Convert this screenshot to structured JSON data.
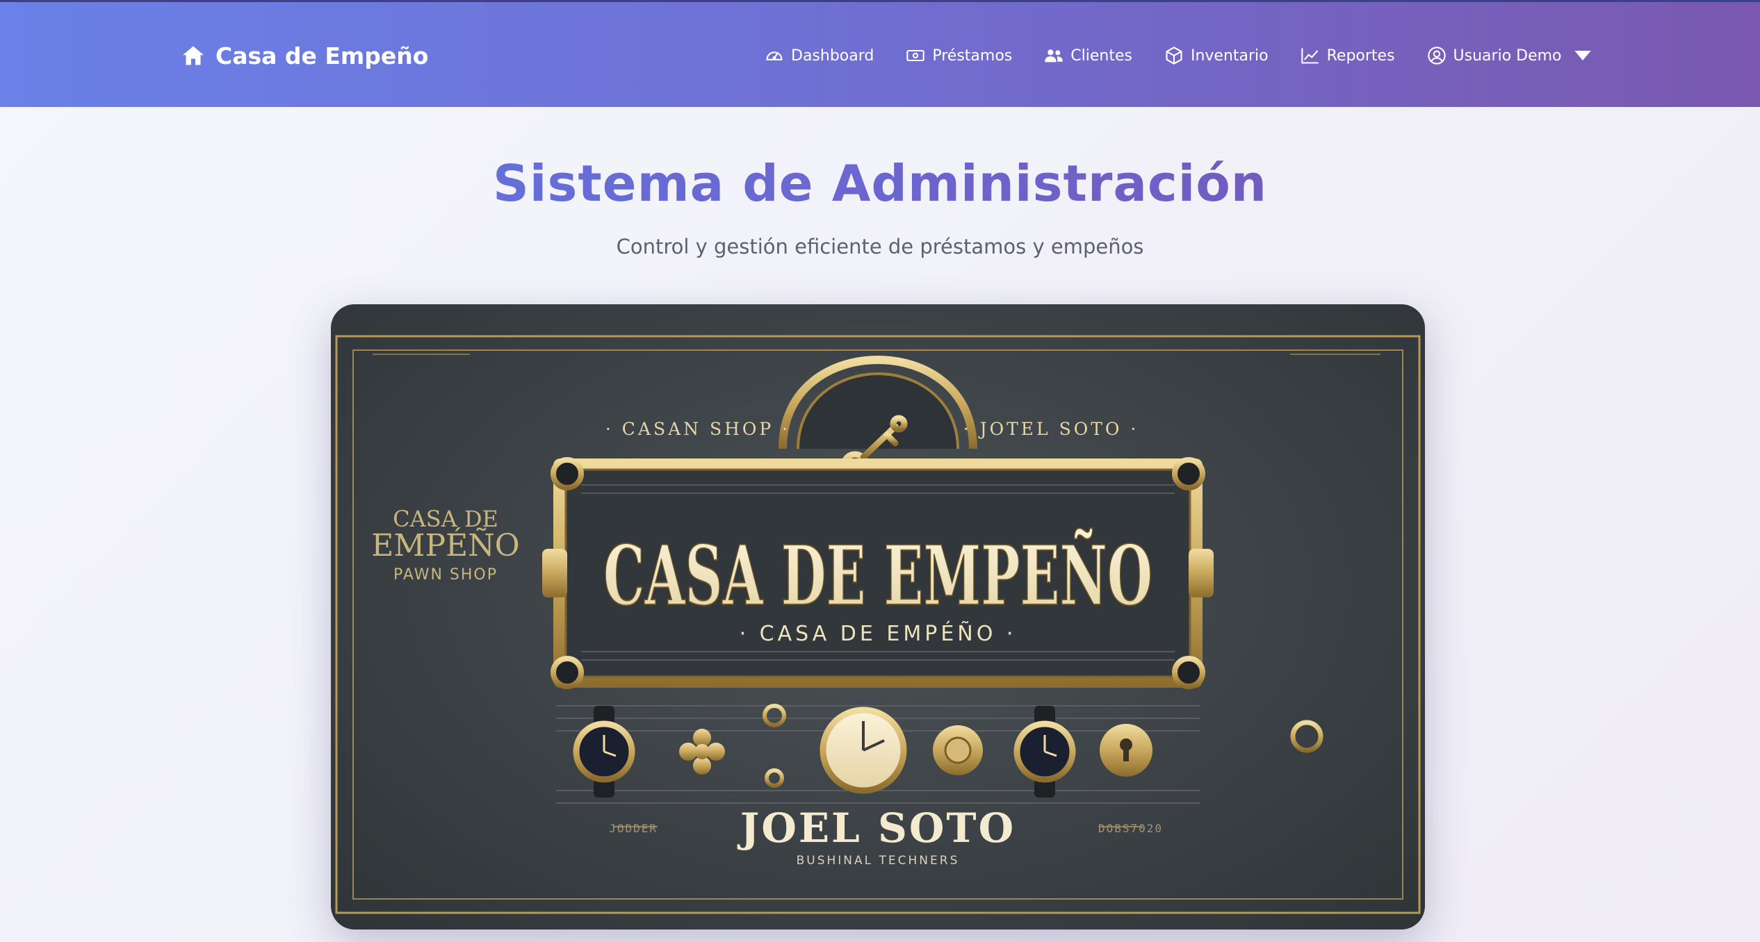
{
  "brand": {
    "name": "Casa de Empeño",
    "icon": "home-icon"
  },
  "nav": {
    "items": [
      {
        "label": "Dashboard",
        "icon": "gauge-icon"
      },
      {
        "label": "Préstamos",
        "icon": "money-icon"
      },
      {
        "label": "Clientes",
        "icon": "users-icon"
      },
      {
        "label": "Inventario",
        "icon": "box-icon"
      },
      {
        "label": "Reportes",
        "icon": "chart-line-icon"
      }
    ],
    "user": {
      "label": "Usuario Demo",
      "icon": "user-circle-icon"
    }
  },
  "hero": {
    "title": "Sistema de Administración",
    "subtitle": "Control y gestión eficiente de préstamos y empeños"
  },
  "banner": {
    "top_left": "· CASAN SHOP ·",
    "top_right": "· JOTEL SOTO ·",
    "main": "CASA DE EMPEÑO",
    "ribbon": "· CASA DE EMPÉÑO ·",
    "side_line1": "CASA DE",
    "side_line2": "EMPÉÑO",
    "side_line3": "PAWN SHOP",
    "owner": "JOEL SOTO",
    "owner_left": "JODDER",
    "owner_right": "DOBS7020",
    "tagline": "BUSHINAL TECHNERS"
  },
  "colors": {
    "nav_start": "#6a81e8",
    "nav_end": "#7a58b0",
    "gold": "#c9a85c",
    "banner_bg": "#3b4145"
  }
}
